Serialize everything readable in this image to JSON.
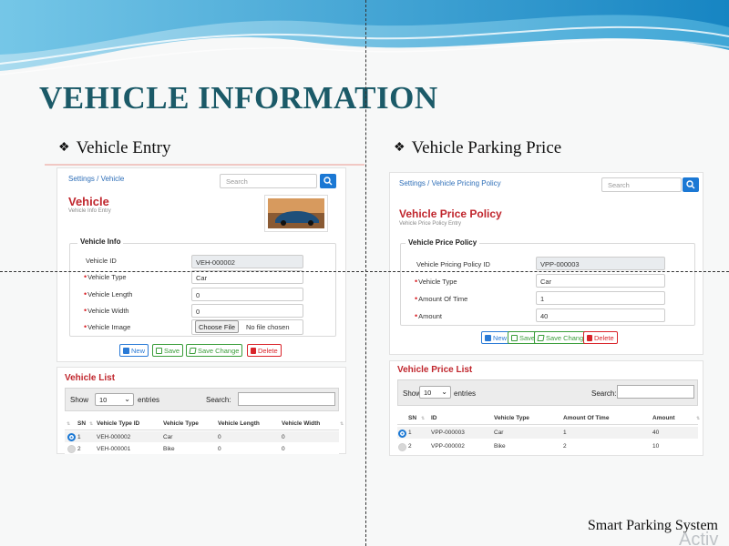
{
  "slide": {
    "title": "VEHICLE INFORMATION",
    "footer": "Smart Parking System",
    "watermark": "Activ"
  },
  "sections": {
    "left_heading": "Vehicle Entry",
    "right_heading": "Vehicle Parking Price",
    "bullet": "❖"
  },
  "vehicle_entry": {
    "breadcrumb": "Settings / Vehicle",
    "search_placeholder": "Search",
    "title": "Vehicle",
    "subtitle": "Vehicle Info Entry",
    "fieldset_legend": "Vehicle Info",
    "fields": {
      "vehicle_id_label": "Vehicle ID",
      "vehicle_id_value": "VEH-000002",
      "vehicle_type_label": "Vehicle Type",
      "vehicle_type_value": "Car",
      "vehicle_length_label": "Vehicle Length",
      "vehicle_length_value": "0",
      "vehicle_width_label": "Vehicle Width",
      "vehicle_width_value": "0",
      "vehicle_image_label": "Vehicle Image",
      "choose_file": "Choose File",
      "no_file": "No file chosen"
    },
    "buttons": {
      "new": "New",
      "save": "Save",
      "save_change": "Save Change",
      "delete": "Delete"
    },
    "list": {
      "title": "Vehicle List",
      "show": "Show",
      "entries_value": "10",
      "entries": "entries",
      "search_label": "Search:",
      "columns": [
        "SN",
        "Vehicle Type ID",
        "Vehicle Type",
        "Vehicle Length",
        "Vehicle Width"
      ],
      "rows": [
        {
          "sn": "1",
          "id": "VEH-000002",
          "type": "Car",
          "length": "0",
          "width": "0",
          "selected": true
        },
        {
          "sn": "2",
          "id": "VEH-000001",
          "type": "Bike",
          "length": "0",
          "width": "0",
          "selected": false
        }
      ]
    }
  },
  "price_policy": {
    "breadcrumb": "Settings / Vehicle Pricing Policy",
    "search_placeholder": "Search",
    "title": "Vehicle Price Policy",
    "subtitle": "Vehicle Price Policy Entry",
    "fieldset_legend": "Vehicle Price Policy",
    "fields": {
      "policy_id_label": "Vehicle Pricing Policy ID",
      "policy_id_value": "VPP-000003",
      "vehicle_type_label": "Vehicle Type",
      "vehicle_type_value": "Car",
      "amount_of_time_label": "Amount Of Time",
      "amount_of_time_value": "1",
      "amount_label": "Amount",
      "amount_value": "40"
    },
    "buttons": {
      "new": "New",
      "save": "Save",
      "save_change": "Save Change",
      "delete": "Delete"
    },
    "list": {
      "title": "Vehicle Price List",
      "show": "Show",
      "entries_value": "10",
      "entries": "entries",
      "search_label": "Search:",
      "columns": [
        "SN",
        "ID",
        "Vehicle Type",
        "Amount Of Time",
        "Amount"
      ],
      "rows": [
        {
          "sn": "1",
          "id": "VPP-000003",
          "type": "Car",
          "time": "1",
          "amount": "40",
          "selected": true
        },
        {
          "sn": "2",
          "id": "VPP-000002",
          "type": "Bike",
          "time": "2",
          "amount": "10",
          "selected": false
        }
      ]
    }
  },
  "colors": {
    "title_teal": "#1b5a68",
    "app_red": "#c0262d",
    "primary_blue": "#1b78d4",
    "success_green": "#3a9d3a",
    "danger_red": "#d9242a"
  }
}
